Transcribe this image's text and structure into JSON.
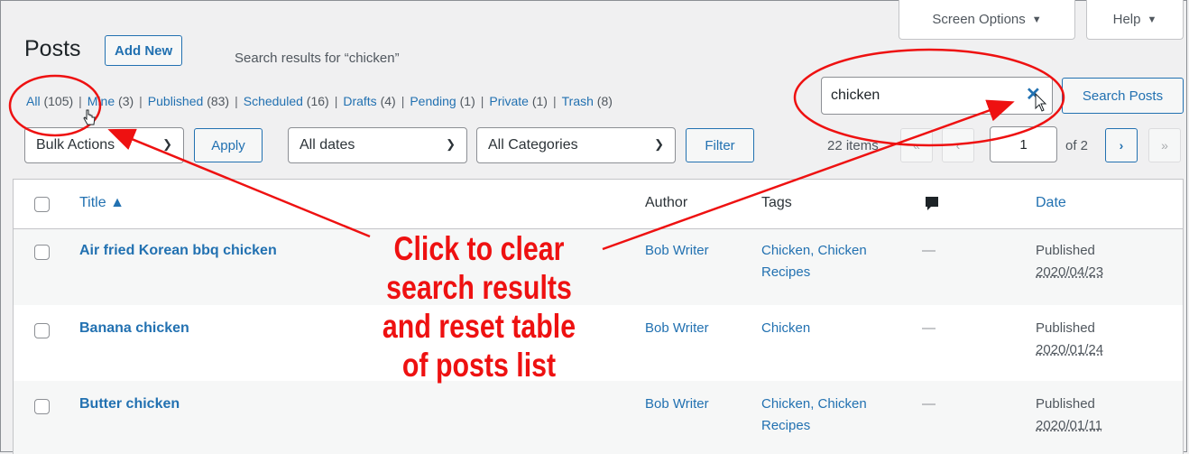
{
  "header": {
    "title": "Posts",
    "add_new": "Add New",
    "search_results": "Search results for “chicken”",
    "screen_options": "Screen Options",
    "help": "Help",
    "dropdown_arrow": "▼"
  },
  "views": [
    {
      "label": "All",
      "count": "(105)"
    },
    {
      "label": "Mine",
      "count": "(3)"
    },
    {
      "label": "Published",
      "count": "(83)"
    },
    {
      "label": "Scheduled",
      "count": "(16)"
    },
    {
      "label": "Drafts",
      "count": "(4)"
    },
    {
      "label": "Pending",
      "count": "(1)"
    },
    {
      "label": "Private",
      "count": "(1)"
    },
    {
      "label": "Trash",
      "count": "(8)"
    }
  ],
  "search": {
    "value": "chicken",
    "button": "Search Posts",
    "clear_glyph": "✕"
  },
  "filters": {
    "bulk_actions": "Bulk Actions",
    "apply": "Apply",
    "dates": "All dates",
    "categories": "All Categories",
    "filter": "Filter"
  },
  "pagination": {
    "items": "22 items",
    "first": "«",
    "prev": "‹",
    "current": "1",
    "of": "of 2",
    "next": "›",
    "last": "»"
  },
  "table": {
    "columns": {
      "title": "Title ▲",
      "author": "Author",
      "tags": "Tags",
      "date": "Date"
    },
    "rows": [
      {
        "title": "Air fried Korean bbq chicken",
        "author": "Bob Writer",
        "tags": "Chicken, Chicken Recipes",
        "comments": "—",
        "status": "Published",
        "date": "2020/04/23"
      },
      {
        "title": "Banana chicken",
        "author": "Bob Writer",
        "tags": "Chicken",
        "comments": "—",
        "status": "Published",
        "date": "2020/01/24"
      },
      {
        "title": "Butter chicken",
        "author": "Bob Writer",
        "tags": "Chicken, Chicken Recipes",
        "comments": "—",
        "status": "Published",
        "date": "2020/01/11"
      }
    ]
  },
  "annotation": {
    "line1": "Click to clear",
    "line2": "search results",
    "line3": "and reset table",
    "line4": "of posts list",
    "color": "#ee1111"
  },
  "colors": {
    "link": "#2271b1",
    "text": "#1d2327",
    "muted": "#50575e",
    "background": "#f0f0f1"
  }
}
